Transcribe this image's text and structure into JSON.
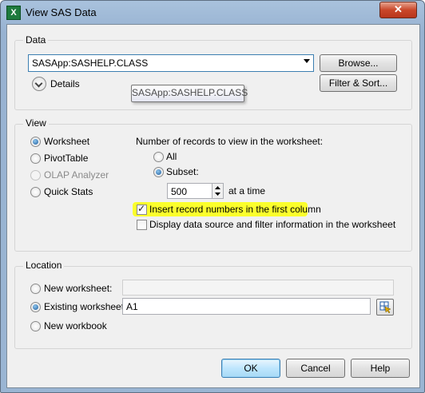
{
  "window": {
    "title": "View SAS Data",
    "app_icon": "excel-icon",
    "close_label": "✕"
  },
  "data_group": {
    "label": "Data",
    "source_value": "SASApp:SASHELP.CLASS",
    "browse_label": "Browse...",
    "filter_sort_label": "Filter & Sort...",
    "details_label": "Details",
    "tooltip_text": "SASApp:SASHELP.CLASS"
  },
  "view_group": {
    "label": "View",
    "options": [
      {
        "label": "Worksheet",
        "checked": true,
        "enabled": true
      },
      {
        "label": "PivotTable",
        "checked": false,
        "enabled": true
      },
      {
        "label": "OLAP Analyzer",
        "checked": false,
        "enabled": false
      },
      {
        "label": "Quick Stats",
        "checked": false,
        "enabled": true
      }
    ],
    "records_heading": "Number of records to view in the worksheet:",
    "all_label": "All",
    "subset_label": "Subset:",
    "subset_value": "500",
    "at_a_time_label": "at a time",
    "insert_record_numbers_label": "Insert record numbers in the first column",
    "insert_record_numbers_checked": true,
    "display_source_label": "Display data source and filter information in the worksheet",
    "display_source_checked": false,
    "highlight_color": "#fbff2c"
  },
  "location_group": {
    "label": "Location",
    "new_worksheet_label": "New worksheet:",
    "new_worksheet_value": "",
    "existing_worksheet_label": "Existing worksheet:",
    "existing_worksheet_value": "A1",
    "new_workbook_label": "New workbook",
    "selected": "existing_worksheet"
  },
  "footer": {
    "ok_label": "OK",
    "cancel_label": "Cancel",
    "help_label": "Help"
  }
}
